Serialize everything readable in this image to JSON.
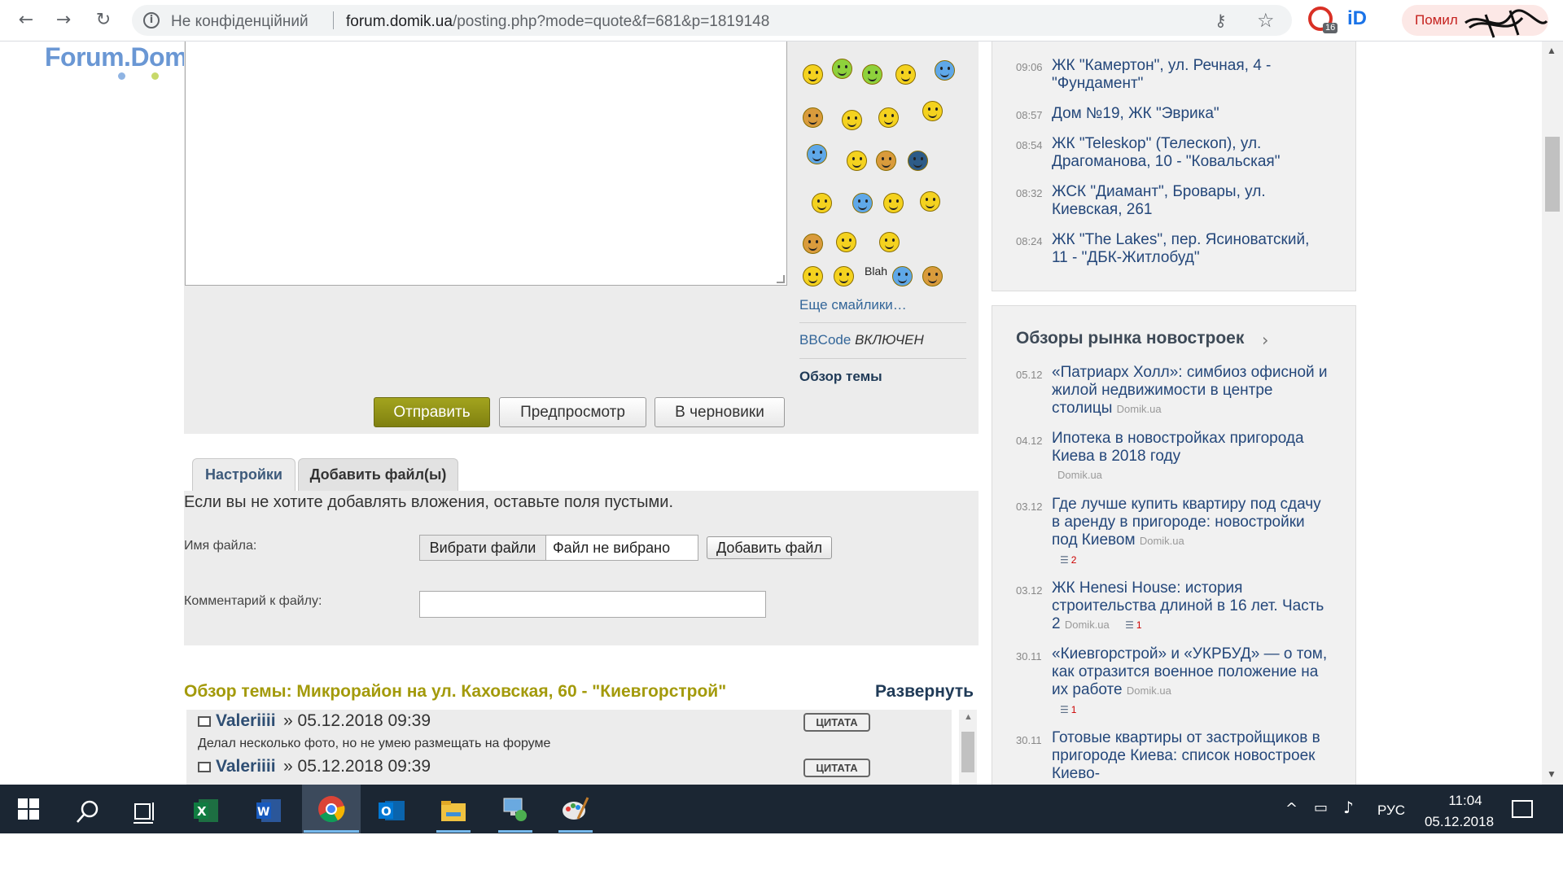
{
  "browser": {
    "security_label": "Не конфіденційний",
    "url_host": "forum.domik.ua",
    "url_path": "/posting.php?mode=quote&f=681&p=1819148",
    "extension_badge": "16",
    "error_pill_label": "Помил",
    "icons": [
      "back-arrow-icon",
      "forward-arrow-icon",
      "reload-icon",
      "info-icon",
      "key-icon",
      "star-icon"
    ]
  },
  "site": {
    "logo_text": "Forum.Domik.ua",
    "logo_dot_colors": [
      "#8fb4e3",
      "#c8d96a",
      "#e17aa0"
    ]
  },
  "editor": {
    "more_smilies": "Еще смайлики…",
    "bbcode_label": "BBCode",
    "bbcode_state": "ВКЛЮЧЕН",
    "review_link": "Обзор темы",
    "blah_label": "Blah",
    "buttons": {
      "submit": "Отправить",
      "preview": "Предпросмотр",
      "drafts": "В черновики"
    }
  },
  "tabs": {
    "settings": "Настройки",
    "add_files": "Добавить файл(ы)"
  },
  "attachments": {
    "note": "Если вы не хотите добавлять вложения, оставьте поля пустыми.",
    "filename_label": "Имя файла:",
    "choose_button": "Вибрати файли",
    "no_file": "Файл не вибрано",
    "add_file_button": "Добавить файл",
    "comment_label": "Комментарий к файлу:",
    "comment_value": ""
  },
  "topic_review": {
    "title": "Обзор темы: Микрорайон на ул. Каховская, 60 - \"Киевгорстрой\"",
    "expand": "Развернуть",
    "quote_label": "ЦИТАТА",
    "separator": "»",
    "posts": [
      {
        "author": "Valeriiii",
        "date": "05.12.2018 09:39",
        "text": "Делал несколько фото, но не умею размещать на форуме"
      },
      {
        "author": "Valeriiii",
        "date": "05.12.2018 09:39",
        "text": ""
      }
    ]
  },
  "news": [
    {
      "time": "09:06",
      "title": "ЖК \"Камертон\", ул. Речная, 4 - \"Фундамент\""
    },
    {
      "time": "08:57",
      "title": "Дом №19, ЖК \"Эврика\""
    },
    {
      "time": "08:54",
      "title": "ЖК \"Teleskop\" (Телескоп), ул. Драгоманова, 10 - \"Ковальская\""
    },
    {
      "time": "08:32",
      "title": "ЖСК \"Диамант\", Бровары, ул. Киевская, 261"
    },
    {
      "time": "08:24",
      "title": "ЖК \"The Lakes\", пер. Ясиноватский, 11 - \"ДБК-Житлобуд\""
    }
  ],
  "market": {
    "heading": "Обзоры рынка новостроек",
    "source": "Domik.ua",
    "items": [
      {
        "date": "05.12",
        "title": "«Патриарх Холл»: симбиоз офисной и жилой недвижимости в центре столицы",
        "comments": ""
      },
      {
        "date": "04.12",
        "title": "Ипотека в новостройках пригорода Киева в 2018 году",
        "comments": ""
      },
      {
        "date": "03.12",
        "title": "Где лучше купить квартиру под сдачу в аренду в пригороде: новостройки под Киевом",
        "comments": "2"
      },
      {
        "date": "03.12",
        "title": "ЖК Henesi House: история строительства длиной в 16 лет. Часть 2",
        "comments": "1"
      },
      {
        "date": "30.11",
        "title": "«Киевгорстрой» и «УКРБУД» — о том, как отразится военное положение на их работе",
        "comments": "1"
      },
      {
        "date": "30.11",
        "title": "Готовые квартиры от застройщиков в пригороде Киева: список новостроек Киево-",
        "comments": ""
      }
    ]
  },
  "taskbar": {
    "apps": [
      "windows-start-icon",
      "search-icon",
      "task-view-icon",
      "excel-icon",
      "word-icon",
      "chrome-icon",
      "outlook-icon",
      "file-explorer-icon",
      "network-app-icon",
      "paint-icon"
    ],
    "language": "РУС",
    "time": "11:04",
    "date": "05.12.2018"
  }
}
